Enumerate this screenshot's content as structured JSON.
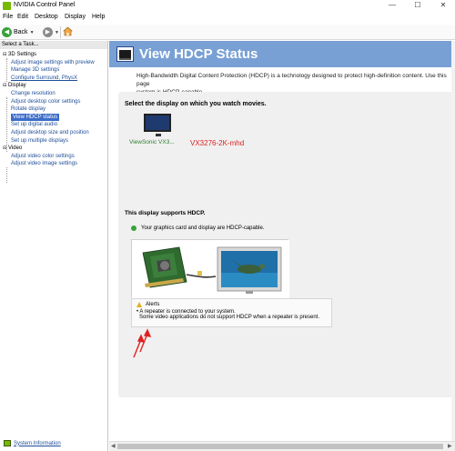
{
  "window": {
    "title": "NVIDIA Control Panel",
    "min_glyph": "—",
    "max_glyph": "☐",
    "close_glyph": "✕"
  },
  "menu": [
    "File",
    "Edit",
    "Desktop",
    "Display",
    "Help"
  ],
  "toolbar": {
    "back_label": "Back",
    "back_icon": "arrow-left-icon",
    "forward_icon": "arrow-right-icon",
    "home_icon": "home-icon"
  },
  "sidebar": {
    "task_header": "Select a Task...",
    "categories": [
      {
        "label": "3D Settings",
        "items": [
          "Adjust image settings with preview",
          "Manage 3D settings",
          "Configure Surround, PhysX"
        ]
      },
      {
        "label": "Display",
        "items": [
          "Change resolution",
          "Adjust desktop color settings",
          "Rotate display",
          "View HDCP status",
          "Set up digital audio",
          "Adjust desktop size and position",
          "Set up multiple displays"
        ]
      },
      {
        "label": "Video",
        "items": [
          "Adjust video color settings",
          "Adjust video image settings"
        ]
      }
    ],
    "selected_item": "View HDCP status",
    "system_info": "System Information"
  },
  "page": {
    "title": "View HDCP Status",
    "description_line1": "High-Bandwidth Digital Content Protection (HDCP) is a technology designed to protect high-definition content. Use this page",
    "description_line2": "system is HDCP-capable.",
    "select_heading": "Select the display on which you watch movies.",
    "display_label": "ViewSonic VX3...",
    "annotation_model": "VX3276-2K-mhd",
    "supports_text": "This display supports HDCP.",
    "capable_text": "Your graphics card and display are HDCP-capable.",
    "alerts": {
      "title": "Alerts",
      "lines": [
        "• A repeater is connected to your system.",
        "Some video applications do not support HDCP when a repeater is present."
      ]
    }
  },
  "colors": {
    "banner": "#78a0d4",
    "selected": "#3c6ec9",
    "link": "#1f4e99",
    "annotation": "#e02020",
    "ok_green": "#3aa23a"
  }
}
